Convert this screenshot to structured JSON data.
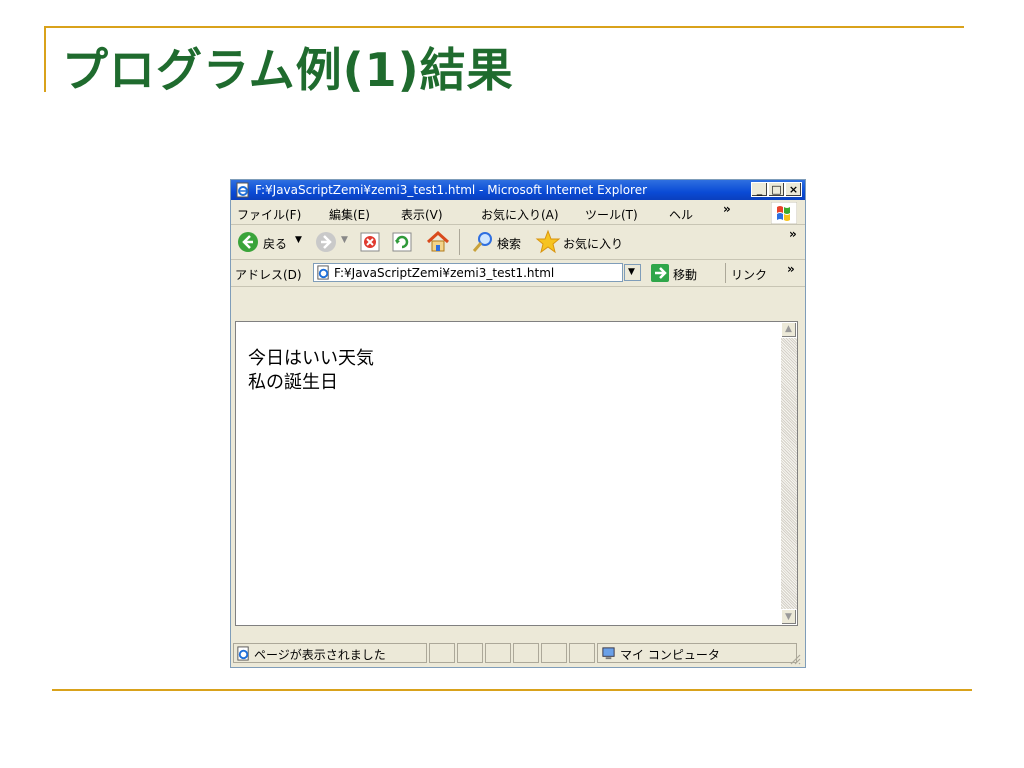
{
  "slide": {
    "title": "プログラム例(1)結果",
    "accent_color": "#d9a21b",
    "title_color": "#1f6b2e"
  },
  "window": {
    "title": "F:¥JavaScriptZemi¥zemi3_test1.html - Microsoft Internet Explorer",
    "controls": {
      "minimize": "_",
      "maximize": "□",
      "close": "×"
    },
    "menu": [
      "ファイル(F)",
      "編集(E)",
      "表示(V)",
      "お気に入り(A)",
      "ツール(T)",
      "ヘル"
    ],
    "menu_overflow": "»",
    "toolbar": {
      "back_label": "戻る",
      "search_label": "検索",
      "favorites_label": "お気に入り",
      "overflow": "»"
    },
    "address": {
      "label": "アドレス(D)",
      "value": "F:¥JavaScriptZemi¥zemi3_test1.html",
      "go_label": "移動",
      "links_label": "リンク",
      "links_overflow": "»"
    },
    "content": {
      "lines": [
        "今日はいい天気",
        "私の誕生日"
      ]
    },
    "status": {
      "message": "ページが表示されました",
      "zone": "マイ コンピュータ"
    }
  },
  "icons": [
    "ie-page-icon",
    "windows-flag-icon",
    "back-arrow-icon",
    "forward-arrow-icon",
    "stop-icon",
    "refresh-icon",
    "home-icon",
    "search-magnifier-icon",
    "favorites-star-icon",
    "go-arrow-icon",
    "my-computer-icon",
    "resize-grip-icon"
  ]
}
